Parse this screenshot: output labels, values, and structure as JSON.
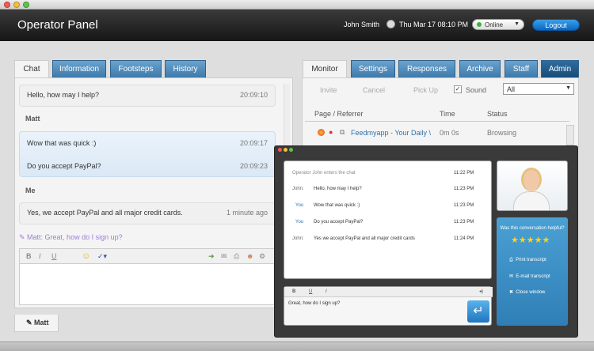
{
  "app": {
    "title": "Operator Panel",
    "user": "John Smith",
    "datetime": "Thu Mar 17 08:10 PM",
    "status": "Online",
    "logout": "Logout"
  },
  "left_tabs": [
    "Chat",
    "Information",
    "Footsteps",
    "History"
  ],
  "chat": {
    "messages": [
      {
        "text": "Hello, how may I help?",
        "time": "20:09:10"
      },
      {
        "text": "Wow that was quick :)",
        "time": "20:09:17"
      },
      {
        "text": "Do you accept PayPal?",
        "time": "20:09:23"
      },
      {
        "text": "Yes, we accept PayPal and all major credit cards.",
        "time": "1 minute ago"
      }
    ],
    "sender_matt": "Matt",
    "sender_me": "Me",
    "typing": "Matt: Great, how do I sign up?",
    "footer_tab": "Matt"
  },
  "right_tabs": [
    "Monitor",
    "Settings",
    "Responses",
    "Archive",
    "Staff",
    "Admin"
  ],
  "monitor": {
    "invite": "Invite",
    "cancel": "Cancel",
    "pickup": "Pick Up",
    "sound": "Sound",
    "filter": "All",
    "columns": [
      "Page / Referrer",
      "Time",
      "Status"
    ],
    "row": {
      "page": "Feedmyapp - Your Daily \\",
      "time": "0m 0s",
      "status": "Browsing"
    }
  },
  "visitor_chat": {
    "system": "Operator John enters the chat",
    "system_time": "11:22 PM",
    "lines": [
      {
        "who": "John:",
        "msg": "Hello, how may I help?",
        "time": "11:23 PM"
      },
      {
        "who": "You",
        "msg": "Wow that was quick :)",
        "time": "11:23 PM"
      },
      {
        "who": "You",
        "msg": "Do you accept PayPal?",
        "time": "11:23 PM"
      },
      {
        "who": "John:",
        "msg": "Yes we accept PayPal and all major credit cards",
        "time": "11:24 PM"
      }
    ],
    "input": "Great, how do I sign up?",
    "helpful": "Was this conversation helpful?",
    "rating": 5,
    "print": "Print transcript",
    "email": "E-mail transcript",
    "close": "Close window"
  },
  "colors": {
    "accent": "#3d79aa",
    "admin": "#1f5a8a",
    "online": "#3cb33c"
  }
}
